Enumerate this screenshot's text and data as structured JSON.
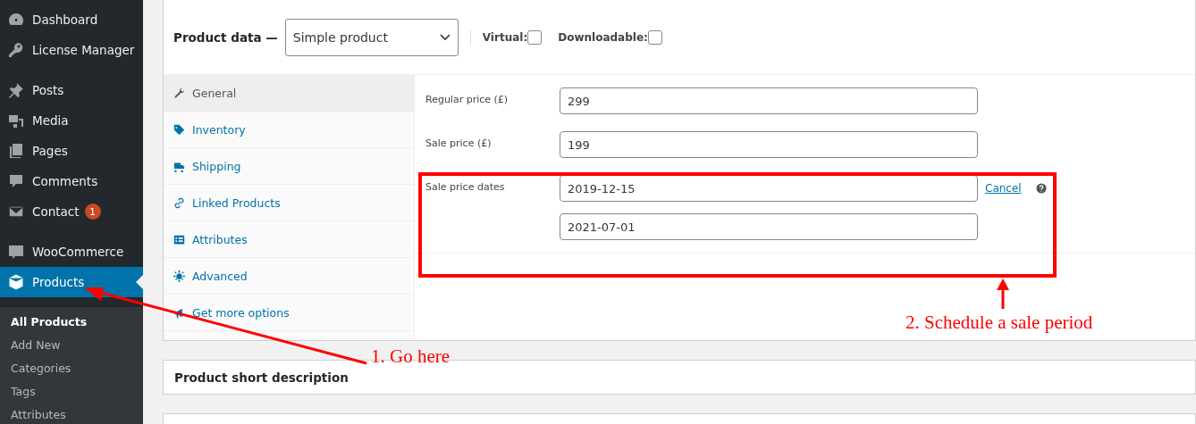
{
  "sidebar": {
    "groups": [
      {
        "items": [
          {
            "label": "Dashboard",
            "selected": false
          },
          {
            "label": "License Manager",
            "selected": false
          }
        ]
      },
      {
        "items": [
          {
            "label": "Posts",
            "selected": false
          },
          {
            "label": "Media",
            "selected": false
          },
          {
            "label": "Pages",
            "selected": false
          },
          {
            "label": "Comments",
            "selected": false
          },
          {
            "label": "Contact",
            "selected": false,
            "badge": "1"
          }
        ]
      },
      {
        "items": [
          {
            "label": "WooCommerce",
            "selected": false
          },
          {
            "label": "Products",
            "selected": true
          }
        ]
      }
    ],
    "submenu": [
      {
        "label": "All Products",
        "selected": true
      },
      {
        "label": "Add New",
        "selected": false
      },
      {
        "label": "Categories",
        "selected": false
      },
      {
        "label": "Tags",
        "selected": false
      },
      {
        "label": "Attributes",
        "selected": false
      }
    ]
  },
  "product_data": {
    "title": "Product data —",
    "type_select": {
      "value": "Simple product"
    },
    "checkboxes": [
      {
        "label": "Virtual:",
        "checked": false
      },
      {
        "label": "Downloadable:",
        "checked": false
      }
    ],
    "tabs": [
      {
        "label": "General",
        "selected": true
      },
      {
        "label": "Inventory",
        "selected": false
      },
      {
        "label": "Shipping",
        "selected": false
      },
      {
        "label": "Linked Products",
        "selected": false
      },
      {
        "label": "Attributes",
        "selected": false
      },
      {
        "label": "Advanced",
        "selected": false
      },
      {
        "label": "Get more options",
        "selected": false
      }
    ],
    "fields": [
      {
        "label": "Regular price (£)",
        "values": [
          "299"
        ]
      },
      {
        "label": "Sale price (£)",
        "values": [
          "199"
        ]
      },
      {
        "label": "Sale price dates",
        "values": [
          "2019-12-15",
          "2021-07-01"
        ],
        "link": "Cancel",
        "help": true
      }
    ]
  },
  "short_description": {
    "title": "Product short description"
  },
  "annotations": [
    {
      "text": "1. Go here"
    },
    {
      "text": "2. Schedule a sale period"
    }
  ]
}
